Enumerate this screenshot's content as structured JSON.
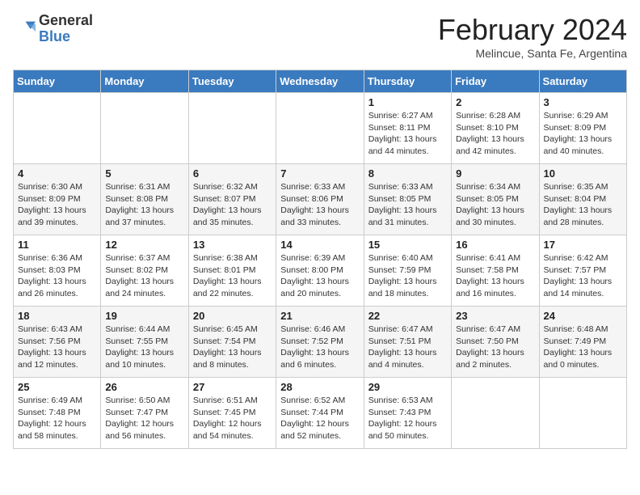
{
  "logo": {
    "general": "General",
    "blue": "Blue"
  },
  "title": "February 2024",
  "subtitle": "Melincue, Santa Fe, Argentina",
  "headers": [
    "Sunday",
    "Monday",
    "Tuesday",
    "Wednesday",
    "Thursday",
    "Friday",
    "Saturday"
  ],
  "weeks": [
    [
      {
        "day": "",
        "info": ""
      },
      {
        "day": "",
        "info": ""
      },
      {
        "day": "",
        "info": ""
      },
      {
        "day": "",
        "info": ""
      },
      {
        "day": "1",
        "info": "Sunrise: 6:27 AM\nSunset: 8:11 PM\nDaylight: 13 hours and 44 minutes."
      },
      {
        "day": "2",
        "info": "Sunrise: 6:28 AM\nSunset: 8:10 PM\nDaylight: 13 hours and 42 minutes."
      },
      {
        "day": "3",
        "info": "Sunrise: 6:29 AM\nSunset: 8:09 PM\nDaylight: 13 hours and 40 minutes."
      }
    ],
    [
      {
        "day": "4",
        "info": "Sunrise: 6:30 AM\nSunset: 8:09 PM\nDaylight: 13 hours and 39 minutes."
      },
      {
        "day": "5",
        "info": "Sunrise: 6:31 AM\nSunset: 8:08 PM\nDaylight: 13 hours and 37 minutes."
      },
      {
        "day": "6",
        "info": "Sunrise: 6:32 AM\nSunset: 8:07 PM\nDaylight: 13 hours and 35 minutes."
      },
      {
        "day": "7",
        "info": "Sunrise: 6:33 AM\nSunset: 8:06 PM\nDaylight: 13 hours and 33 minutes."
      },
      {
        "day": "8",
        "info": "Sunrise: 6:33 AM\nSunset: 8:05 PM\nDaylight: 13 hours and 31 minutes."
      },
      {
        "day": "9",
        "info": "Sunrise: 6:34 AM\nSunset: 8:05 PM\nDaylight: 13 hours and 30 minutes."
      },
      {
        "day": "10",
        "info": "Sunrise: 6:35 AM\nSunset: 8:04 PM\nDaylight: 13 hours and 28 minutes."
      }
    ],
    [
      {
        "day": "11",
        "info": "Sunrise: 6:36 AM\nSunset: 8:03 PM\nDaylight: 13 hours and 26 minutes."
      },
      {
        "day": "12",
        "info": "Sunrise: 6:37 AM\nSunset: 8:02 PM\nDaylight: 13 hours and 24 minutes."
      },
      {
        "day": "13",
        "info": "Sunrise: 6:38 AM\nSunset: 8:01 PM\nDaylight: 13 hours and 22 minutes."
      },
      {
        "day": "14",
        "info": "Sunrise: 6:39 AM\nSunset: 8:00 PM\nDaylight: 13 hours and 20 minutes."
      },
      {
        "day": "15",
        "info": "Sunrise: 6:40 AM\nSunset: 7:59 PM\nDaylight: 13 hours and 18 minutes."
      },
      {
        "day": "16",
        "info": "Sunrise: 6:41 AM\nSunset: 7:58 PM\nDaylight: 13 hours and 16 minutes."
      },
      {
        "day": "17",
        "info": "Sunrise: 6:42 AM\nSunset: 7:57 PM\nDaylight: 13 hours and 14 minutes."
      }
    ],
    [
      {
        "day": "18",
        "info": "Sunrise: 6:43 AM\nSunset: 7:56 PM\nDaylight: 13 hours and 12 minutes."
      },
      {
        "day": "19",
        "info": "Sunrise: 6:44 AM\nSunset: 7:55 PM\nDaylight: 13 hours and 10 minutes."
      },
      {
        "day": "20",
        "info": "Sunrise: 6:45 AM\nSunset: 7:54 PM\nDaylight: 13 hours and 8 minutes."
      },
      {
        "day": "21",
        "info": "Sunrise: 6:46 AM\nSunset: 7:52 PM\nDaylight: 13 hours and 6 minutes."
      },
      {
        "day": "22",
        "info": "Sunrise: 6:47 AM\nSunset: 7:51 PM\nDaylight: 13 hours and 4 minutes."
      },
      {
        "day": "23",
        "info": "Sunrise: 6:47 AM\nSunset: 7:50 PM\nDaylight: 13 hours and 2 minutes."
      },
      {
        "day": "24",
        "info": "Sunrise: 6:48 AM\nSunset: 7:49 PM\nDaylight: 13 hours and 0 minutes."
      }
    ],
    [
      {
        "day": "25",
        "info": "Sunrise: 6:49 AM\nSunset: 7:48 PM\nDaylight: 12 hours and 58 minutes."
      },
      {
        "day": "26",
        "info": "Sunrise: 6:50 AM\nSunset: 7:47 PM\nDaylight: 12 hours and 56 minutes."
      },
      {
        "day": "27",
        "info": "Sunrise: 6:51 AM\nSunset: 7:45 PM\nDaylight: 12 hours and 54 minutes."
      },
      {
        "day": "28",
        "info": "Sunrise: 6:52 AM\nSunset: 7:44 PM\nDaylight: 12 hours and 52 minutes."
      },
      {
        "day": "29",
        "info": "Sunrise: 6:53 AM\nSunset: 7:43 PM\nDaylight: 12 hours and 50 minutes."
      },
      {
        "day": "",
        "info": ""
      },
      {
        "day": "",
        "info": ""
      }
    ]
  ]
}
